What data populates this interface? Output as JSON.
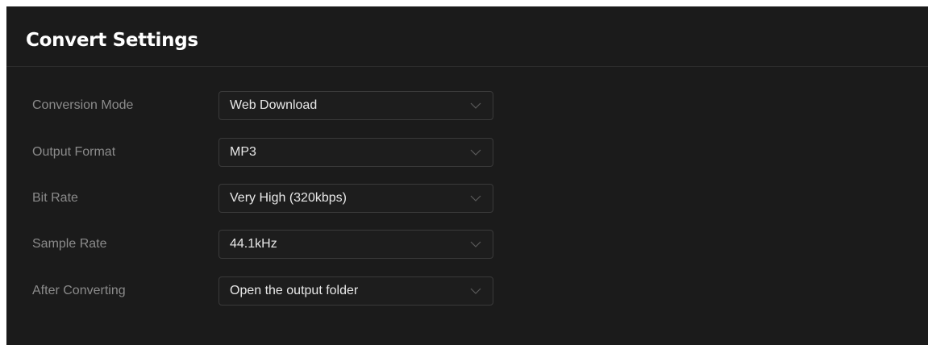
{
  "header": {
    "title": "Convert Settings"
  },
  "settings": [
    {
      "label": "Conversion Mode",
      "value": "Web Download"
    },
    {
      "label": "Output Format",
      "value": "MP3"
    },
    {
      "label": "Bit Rate",
      "value": "Very High (320kbps)"
    },
    {
      "label": "Sample Rate",
      "value": "44.1kHz"
    },
    {
      "label": "After Converting",
      "value": "Open the output folder"
    }
  ],
  "icons": {
    "dropdown": "chevron-down-icon"
  },
  "colors": {
    "background": "#1b1b1b",
    "label_text": "#8b8b8b",
    "value_text": "#e8e8e8",
    "title_text": "#ffffff",
    "field_border": "#3a3a3a"
  }
}
